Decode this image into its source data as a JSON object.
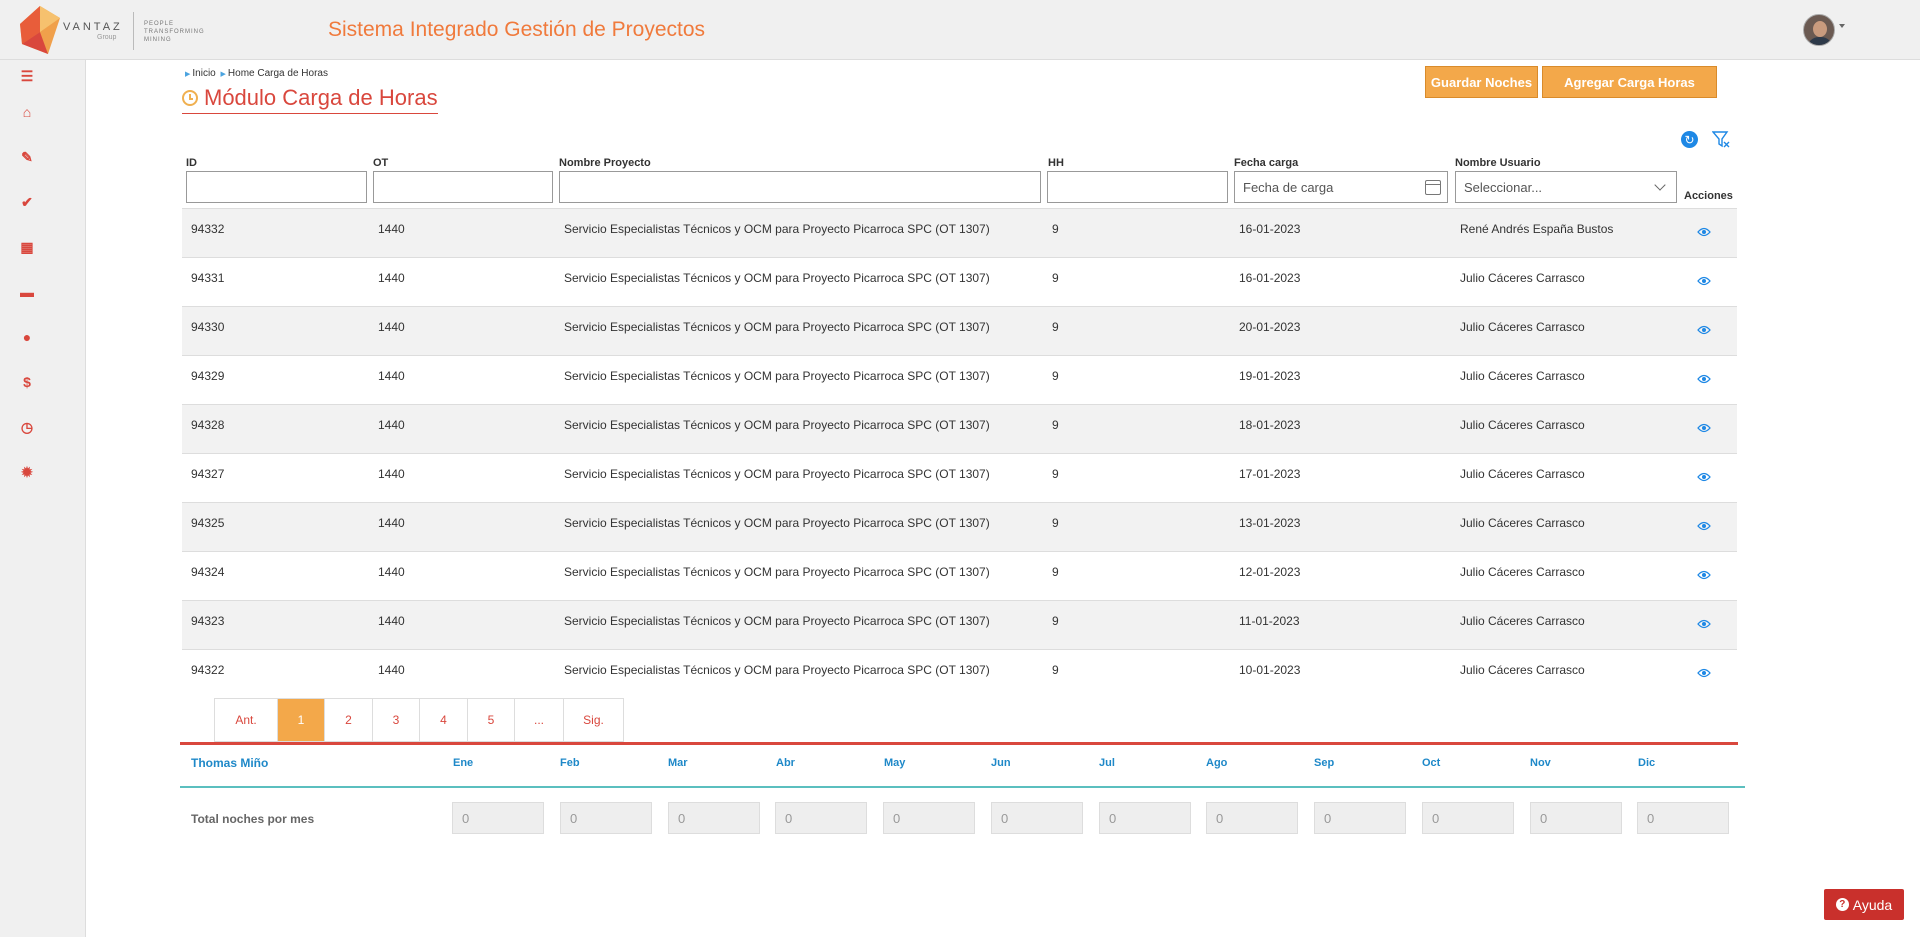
{
  "brand": {
    "name": "VANTAZ",
    "group": "Group",
    "tagline_1": "PEOPLE",
    "tagline_2": "TRANSFORMING",
    "tagline_3": "MINING"
  },
  "header": {
    "title": "Sistema Integrado Gestión de Proyectos"
  },
  "sidebar": {
    "items": [
      {
        "icon": "menu-icon",
        "glyph": "☰"
      },
      {
        "icon": "home-icon",
        "glyph": "⌂"
      },
      {
        "icon": "pin-icon",
        "glyph": "✎"
      },
      {
        "icon": "check-icon",
        "glyph": "✔"
      },
      {
        "icon": "calendar-icon",
        "glyph": "▦"
      },
      {
        "icon": "briefcase-icon",
        "glyph": "▬"
      },
      {
        "icon": "user-icon",
        "glyph": "●"
      },
      {
        "icon": "dollar-icon",
        "glyph": "$"
      },
      {
        "icon": "clock-icon",
        "glyph": "◷"
      },
      {
        "icon": "gear-icon",
        "glyph": "✹"
      }
    ]
  },
  "breadcrumb": {
    "item1": "Inicio",
    "item2": "Home Carga de Horas"
  },
  "page": {
    "title": "Módulo Carga de Horas"
  },
  "actions": {
    "guardar_noches": "Guardar Noches",
    "agregar_carga": "Agregar Carga Horas"
  },
  "filters": {
    "id_label": "ID",
    "ot_label": "OT",
    "proyecto_label": "Nombre Proyecto",
    "hh_label": "HH",
    "fecha_label": "Fecha carga",
    "fecha_placeholder": "Fecha de carga",
    "usuario_label": "Nombre Usuario",
    "usuario_placeholder": "Seleccionar...",
    "acciones_label": "Acciones"
  },
  "rows": [
    {
      "id": "94332",
      "ot": "1440",
      "proyecto": "Servicio Especialistas Técnicos y OCM para Proyecto Picarroca SPC (OT 1307)",
      "hh": "9",
      "fecha": "16-01-2023",
      "usuario": "René Andrés España Bustos"
    },
    {
      "id": "94331",
      "ot": "1440",
      "proyecto": "Servicio Especialistas Técnicos y OCM para Proyecto Picarroca SPC (OT 1307)",
      "hh": "9",
      "fecha": "16-01-2023",
      "usuario": "Julio Cáceres Carrasco"
    },
    {
      "id": "94330",
      "ot": "1440",
      "proyecto": "Servicio Especialistas Técnicos y OCM para Proyecto Picarroca SPC (OT 1307)",
      "hh": "9",
      "fecha": "20-01-2023",
      "usuario": "Julio Cáceres Carrasco"
    },
    {
      "id": "94329",
      "ot": "1440",
      "proyecto": "Servicio Especialistas Técnicos y OCM para Proyecto Picarroca SPC (OT 1307)",
      "hh": "9",
      "fecha": "19-01-2023",
      "usuario": "Julio Cáceres Carrasco"
    },
    {
      "id": "94328",
      "ot": "1440",
      "proyecto": "Servicio Especialistas Técnicos y OCM para Proyecto Picarroca SPC (OT 1307)",
      "hh": "9",
      "fecha": "18-01-2023",
      "usuario": "Julio Cáceres Carrasco"
    },
    {
      "id": "94327",
      "ot": "1440",
      "proyecto": "Servicio Especialistas Técnicos y OCM para Proyecto Picarroca SPC (OT 1307)",
      "hh": "9",
      "fecha": "17-01-2023",
      "usuario": "Julio Cáceres Carrasco"
    },
    {
      "id": "94325",
      "ot": "1440",
      "proyecto": "Servicio Especialistas Técnicos y OCM para Proyecto Picarroca SPC (OT 1307)",
      "hh": "9",
      "fecha": "13-01-2023",
      "usuario": "Julio Cáceres Carrasco"
    },
    {
      "id": "94324",
      "ot": "1440",
      "proyecto": "Servicio Especialistas Técnicos y OCM para Proyecto Picarroca SPC (OT 1307)",
      "hh": "9",
      "fecha": "12-01-2023",
      "usuario": "Julio Cáceres Carrasco"
    },
    {
      "id": "94323",
      "ot": "1440",
      "proyecto": "Servicio Especialistas Técnicos y OCM para Proyecto Picarroca SPC (OT 1307)",
      "hh": "9",
      "fecha": "11-01-2023",
      "usuario": "Julio Cáceres Carrasco"
    },
    {
      "id": "94322",
      "ot": "1440",
      "proyecto": "Servicio Especialistas Técnicos y OCM para Proyecto Picarroca SPC (OT 1307)",
      "hh": "9",
      "fecha": "10-01-2023",
      "usuario": "Julio Cáceres Carrasco"
    }
  ],
  "pagination": {
    "items": [
      {
        "label": "Ant.",
        "active": false
      },
      {
        "label": "1",
        "active": true
      },
      {
        "label": "2",
        "active": false
      },
      {
        "label": "3",
        "active": false
      },
      {
        "label": "4",
        "active": false
      },
      {
        "label": "5",
        "active": false
      },
      {
        "label": "...",
        "active": false
      },
      {
        "label": "Sig.",
        "active": false
      }
    ]
  },
  "summary": {
    "user_name": "Thomas Miño",
    "months": [
      "Ene",
      "Feb",
      "Mar",
      "Abr",
      "May",
      "Jun",
      "Jul",
      "Ago",
      "Sep",
      "Oct",
      "Nov",
      "Dic"
    ],
    "row_label": "Total noches por mes",
    "values": [
      "0",
      "0",
      "0",
      "0",
      "0",
      "0",
      "0",
      "0",
      "0",
      "0",
      "0",
      "0"
    ]
  },
  "help": {
    "label": "Ayuda"
  },
  "colors": {
    "brand_orange": "#f07a3c",
    "accent_red": "#d9473d",
    "button_orange": "#f3a84a",
    "link_blue": "#1e88c8"
  }
}
